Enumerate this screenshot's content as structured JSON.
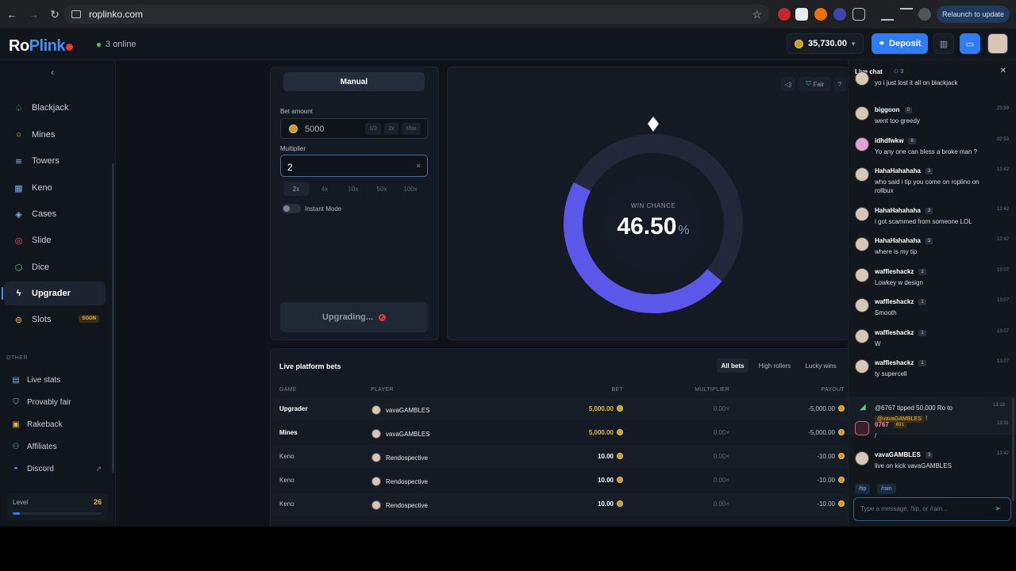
{
  "browser": {
    "url": "roplinko.com",
    "relaunch_label": "Relaunch to update"
  },
  "header": {
    "logo_part1": "Ro",
    "logo_part2": "Plink",
    "online_text": "3 online",
    "balance": "35,730.00",
    "deposit_label": "Deposit"
  },
  "sidebar": {
    "items": [
      {
        "label": "Blackjack",
        "icon": "spade-icon"
      },
      {
        "label": "Mines",
        "icon": "bomb-icon"
      },
      {
        "label": "Towers",
        "icon": "layers-icon"
      },
      {
        "label": "Keno",
        "icon": "grid-icon"
      },
      {
        "label": "Cases",
        "icon": "box-icon"
      },
      {
        "label": "Slide",
        "icon": "target-icon"
      },
      {
        "label": "Dice",
        "icon": "dice-icon"
      },
      {
        "label": "Upgrader",
        "icon": "bolt-icon"
      },
      {
        "label": "Slots",
        "icon": "coins-icon",
        "badge": "SOON"
      }
    ],
    "other_heading": "OTHER",
    "other_items": [
      {
        "label": "Live stats"
      },
      {
        "label": "Provably fair"
      },
      {
        "label": "Rakeback"
      },
      {
        "label": "Affiliates"
      },
      {
        "label": "Discord"
      }
    ],
    "level_label": "Level",
    "level_value": "26",
    "level_progress": 0.08
  },
  "bet_panel": {
    "mode_tab": "Manual",
    "bet_amount_label": "Bet amount",
    "bet_amount_value": "5000",
    "bet_buttons": [
      "1/2",
      "2x",
      "Max"
    ],
    "multiplier_label": "Multiplier",
    "multiplier_value": "2",
    "multiplier_chips": [
      "2x",
      "4x",
      "10x",
      "50x",
      "100x"
    ],
    "instant_mode_label": "Instant Mode",
    "action_label": "Upgrading..."
  },
  "game": {
    "fair_label": "Fair",
    "help_label": "?",
    "win_chance_label": "WIN CHANCE",
    "win_chance_value": "46.50",
    "win_chance_unit": "%",
    "win_chance_fraction": 0.465
  },
  "bets": {
    "title": "Live platform bets",
    "tabs": [
      "All bets",
      "High rollers",
      "Lucky wins"
    ],
    "columns": [
      "GAME",
      "PLAYER",
      "BET",
      "MULTIPLIER",
      "PAYOUT"
    ],
    "rows": [
      {
        "game": "Upgrader",
        "player": "vavaGAMBLES",
        "bet": "5,000.00",
        "multiplier": "0.00×",
        "payout": "-5,000.00"
      },
      {
        "game": "Mines",
        "player": "vavaGAMBLES",
        "bet": "5,000.00",
        "multiplier": "0.00×",
        "payout": "-5,000.00"
      },
      {
        "game": "Keno",
        "player": "Rendospective",
        "bet": "10.00",
        "multiplier": "0.00×",
        "payout": "-10.00"
      },
      {
        "game": "Keno",
        "player": "Rendospective",
        "bet": "10.00",
        "multiplier": "0.00×",
        "payout": "-10.00"
      },
      {
        "game": "Keno",
        "player": "Rendospective",
        "bet": "10.00",
        "multiplier": "0.00×",
        "payout": "-10.00"
      }
    ]
  },
  "chat": {
    "title": "Live chat",
    "count": "3",
    "first_text": "yo i just lost it all on blackjack",
    "messages": [
      {
        "name": "biggoon",
        "level": "0",
        "time": "23:59",
        "text": "went too greedy"
      },
      {
        "name": "idhdfwkw",
        "level": "8",
        "time": "02:53",
        "text": "Yo any one can bless a broke man ?"
      },
      {
        "name": "HahaHahahaha",
        "level": "3",
        "time": "12:42",
        "text": "who said i tip you come on roplino on rollbux"
      },
      {
        "name": "HahaHahahaha",
        "level": "3",
        "time": "12:42",
        "text": "i got scammed from someone LOL"
      },
      {
        "name": "HahaHahahaha",
        "level": "3",
        "time": "12:42",
        "text": "where is my tip"
      },
      {
        "name": "waffleshackz",
        "level": "1",
        "time": "13:07",
        "text": "Lowkey w design"
      },
      {
        "name": "waffleshackz",
        "level": "1",
        "time": "13:07",
        "text": "Smooth"
      },
      {
        "name": "waffleshackz",
        "level": "1",
        "time": "13:07",
        "text": "W"
      },
      {
        "name": "waffleshackz",
        "level": "1",
        "time": "13:07",
        "text": "ty supercell"
      }
    ],
    "tip": {
      "text": "@6767 tipped 50,000 Ro to",
      "mention": "@vavaGAMBLES",
      "suffix": "!",
      "time": "13:18"
    },
    "after": [
      {
        "name": "6767",
        "level": "691",
        "time": "13:31",
        "text": "/"
      },
      {
        "name": "vavaGAMBLES",
        "level": "3",
        "time": "13:42",
        "text": "live on kick vavaGAMBLES"
      }
    ],
    "commands": [
      "/tip",
      "/rain"
    ],
    "input_placeholder": "Type a message, /tip, or /rain..."
  },
  "colors": {
    "accent": "#2f7df6",
    "ring": "#5b57e8",
    "gold": "#e8b84a"
  }
}
